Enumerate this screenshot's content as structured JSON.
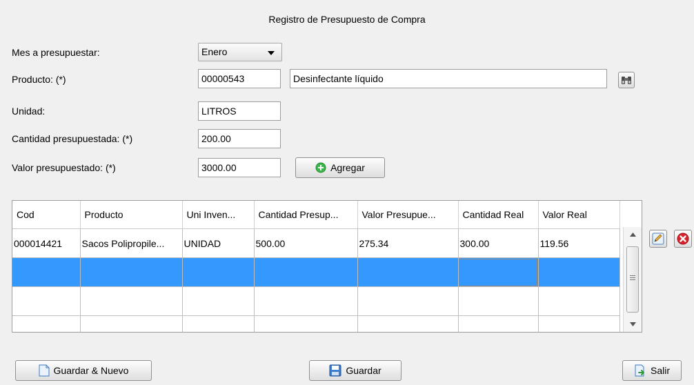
{
  "window": {
    "title": "Registro de Presupuesto de Compra"
  },
  "form": {
    "mes_label": "Mes a presupuestar:",
    "mes_value": "Enero",
    "producto_label": "Producto: (*)",
    "producto_code": "00000543",
    "producto_name": "Desinfectante líquido",
    "unidad_label": "Unidad:",
    "unidad_value": "LITROS",
    "cantidad_label": "Cantidad presupuestada: (*)",
    "cantidad_value": "200.00",
    "valor_label": "Valor presupuestado: (*)",
    "valor_value": "3000.00",
    "agregar_label": "Agregar"
  },
  "table": {
    "columns": [
      "Cod",
      "Producto",
      "Uni Inven...",
      "Cantidad Presup...",
      "Valor Presupue...",
      "Cantidad Real",
      "Valor Real"
    ],
    "rows": [
      [
        "000014421",
        "Sacos Polipropile...",
        "UNIDAD",
        "500.00",
        "275.34",
        "300.00",
        "119.56"
      ],
      [
        "",
        "",
        "",
        "",
        "",
        "",
        ""
      ],
      [
        "",
        "",
        "",
        "",
        "",
        "",
        ""
      ],
      [
        "",
        "",
        "",
        "",
        "",
        "",
        ""
      ]
    ],
    "selected_row": 1
  },
  "footer": {
    "guardar_nuevo_label": "Guardar & Nuevo",
    "guardar_label": "Guardar",
    "salir_label": "Salir"
  },
  "colors": {
    "selection": "#3399ff",
    "agregar_icon": "#3cb84a",
    "delete_icon": "#d9232d"
  },
  "icons": [
    "binoculars-icon",
    "add-icon",
    "edit-icon",
    "delete-icon",
    "document-icon",
    "save-icon",
    "exit-icon",
    "scroll-up-icon",
    "scroll-down-icon"
  ]
}
